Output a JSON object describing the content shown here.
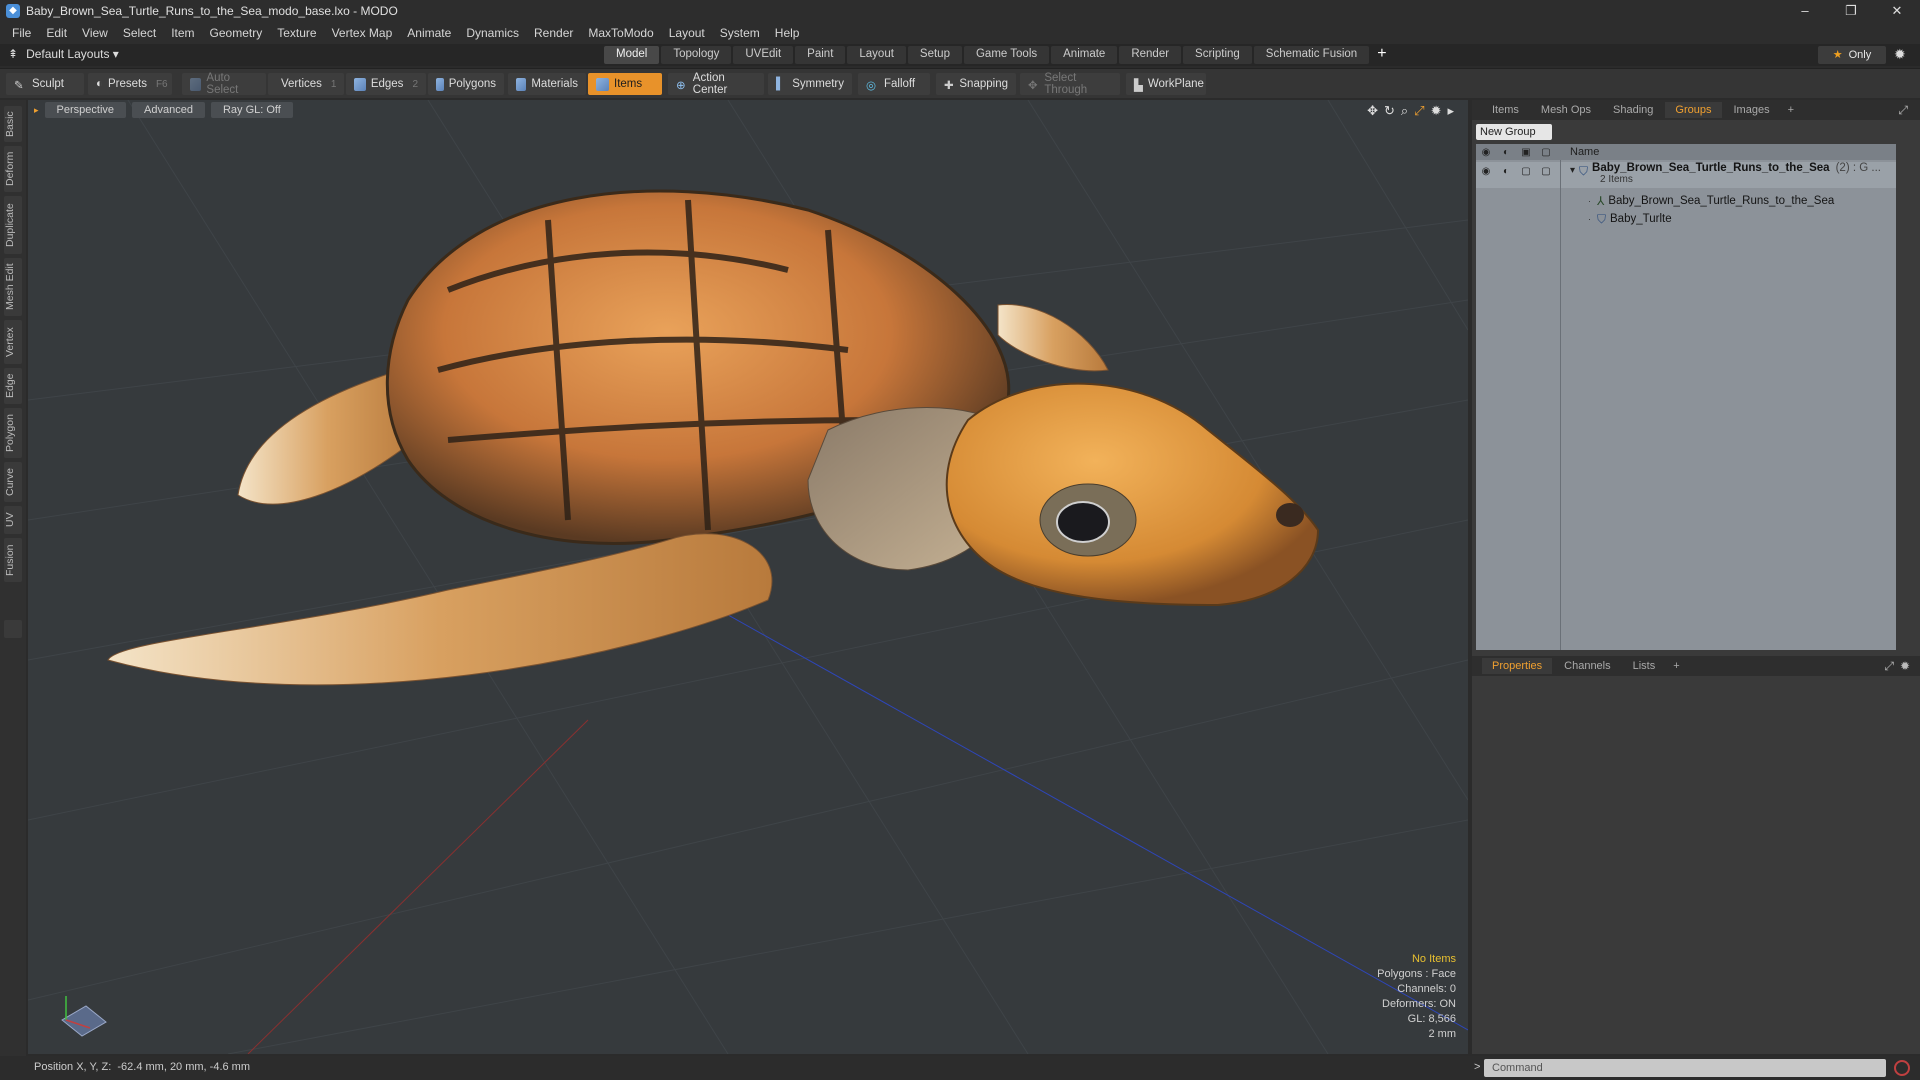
{
  "window": {
    "title": "Baby_Brown_Sea_Turtle_Runs_to_the_Sea_modo_base.lxo - MODO",
    "minimize": "–",
    "restore": "❐",
    "close": "✕"
  },
  "menu": [
    "File",
    "Edit",
    "View",
    "Select",
    "Item",
    "Geometry",
    "Texture",
    "Vertex Map",
    "Animate",
    "Dynamics",
    "Render",
    "MaxToModo",
    "Layout",
    "System",
    "Help"
  ],
  "layouts": {
    "label": "Default Layouts ▾"
  },
  "mode_tabs": [
    "Model",
    "Topology",
    "UVEdit",
    "Paint",
    "Layout",
    "Setup",
    "Game Tools",
    "Animate",
    "Render",
    "Scripting",
    "Schematic Fusion"
  ],
  "mode_active": "Model",
  "only_label": "Only",
  "toolbar": {
    "sculpt": "Sculpt",
    "presets": "Presets",
    "presets_hint": "F6",
    "auto_select": "Auto Select",
    "vertices": "Vertices",
    "vertices_count": "1",
    "edges": "Edges",
    "edges_count": "2",
    "polygons": "Polygons",
    "materials": "Materials",
    "items": "Items",
    "action_center": "Action Center",
    "symmetry": "Symmetry",
    "falloff": "Falloff",
    "snapping": "Snapping",
    "select_through": "Select Through",
    "workplane": "WorkPlane"
  },
  "left_tabs": [
    "Basic",
    "Deform",
    "Duplicate",
    "Mesh Edit",
    "Vertex",
    "Edge",
    "Polygon",
    "Curve",
    "UV",
    "Fusion"
  ],
  "viewport": {
    "view": "Perspective",
    "shading": "Advanced",
    "raygl": "Ray GL: Off",
    "info": {
      "selection": "No Items",
      "polygons": "Polygons : Face",
      "channels": "Channels: 0",
      "deformers": "Deformers: ON",
      "gl": "GL: 8,566",
      "grid": "2 mm"
    }
  },
  "groups_panel": {
    "tabs": [
      "Items",
      "Mesh Ops",
      "Shading",
      "Groups",
      "Images"
    ],
    "active_tab": "Groups",
    "new_group": "New Group",
    "column_name": "Name",
    "group_name": "Baby_Brown_Sea_Turtle_Runs_to_the_Sea",
    "group_suffix": "(2) : G ...",
    "group_count": "2 Items",
    "children": [
      "Baby_Brown_Sea_Turtle_Runs_to_the_Sea",
      "Baby_Turlte"
    ]
  },
  "props_panel": {
    "tabs": [
      "Properties",
      "Channels",
      "Lists"
    ],
    "active_tab": "Properties"
  },
  "status": {
    "position_label": "Position X, Y, Z:",
    "position_value": "-62.4 mm, 20 mm, -4.6 mm",
    "command_placeholder": "Command"
  },
  "colors": {
    "accent": "#e8922a",
    "tab_active_text": "#f0a030",
    "viewport_bg": "#363a3d"
  }
}
